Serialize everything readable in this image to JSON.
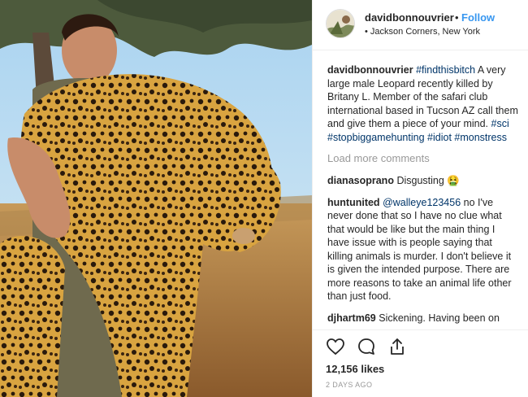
{
  "post": {
    "username": "davidbonnouvrier",
    "separator": "•",
    "follow_label": "Follow",
    "location": "• Jackson Corners, New York"
  },
  "comments": [
    {
      "user": "davidbonnouvrier",
      "segments": [
        {
          "text": "#findthisbitch",
          "tag": true
        },
        {
          "text": " A very large male Leopard recently killed by Britany L. Member of the safari club international based in Tucson AZ call them and give them a piece of your mind. ",
          "tag": false
        },
        {
          "text": "#sci",
          "tag": true
        },
        {
          "text": " ",
          "tag": false
        },
        {
          "text": "#stopbiggamehunting",
          "tag": true
        },
        {
          "text": " ",
          "tag": false
        },
        {
          "text": "#idiot",
          "tag": true
        },
        {
          "text": " ",
          "tag": false
        },
        {
          "text": "#monstress",
          "tag": true
        }
      ]
    }
  ],
  "load_more_label": "Load more comments",
  "more_comments": [
    {
      "user": "dianasoprano",
      "segments": [
        {
          "text": "Disgusting 🤮",
          "tag": false
        }
      ]
    },
    {
      "user": "huntunited",
      "segments": [
        {
          "text": "@walleye123456",
          "tag": true
        },
        {
          "text": " no I've never done that so I have no clue what that would be like but the main thing I have issue with is people saying that killing animals is murder. I don't believe it is given the intended purpose. There are more reasons to take an animal life other than just food.",
          "tag": false
        }
      ]
    },
    {
      "user": "djhartm69",
      "segments": [
        {
          "text": "Sickening. Having been on safari in Kenya & Tanzania, how this is",
          "tag": false
        }
      ]
    }
  ],
  "likes": "12,156 likes",
  "timestamp": "2 DAYS AGO",
  "icons": [
    "heart-icon",
    "comment-icon",
    "share-icon"
  ],
  "colors": {
    "link": "#3897f0",
    "hashtag": "#003569",
    "muted": "#999999"
  }
}
